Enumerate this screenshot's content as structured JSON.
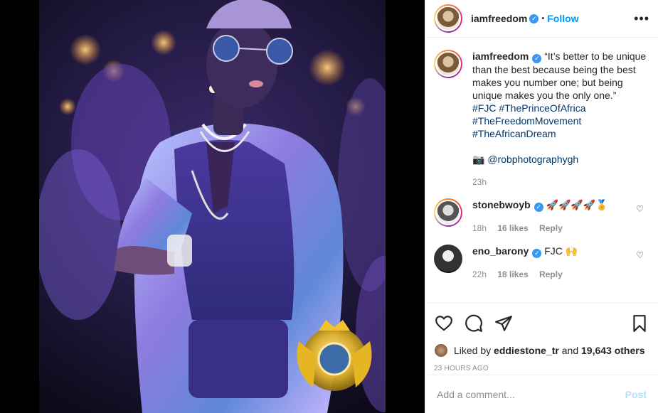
{
  "post": {
    "author": "iamfreedom",
    "follow_label": "Follow",
    "separator": "•",
    "more_label": "•••",
    "verified_mark": "✓",
    "caption": {
      "quote": "“It’s better to be unique than the best because being the best makes you number one; but being unique makes you the only one.”",
      "hashtags": [
        "#FJC #ThePrinceOfAfrica",
        "#TheFreedomMovement",
        "#TheAfricanDream"
      ],
      "camera_emoji": "📷",
      "credit": "@robphotographygh",
      "time": "23h"
    },
    "comments": [
      {
        "user": "stonebwoyb",
        "verified": true,
        "text": "🚀🚀🚀🚀🏅",
        "time": "18h",
        "likes": "16 likes",
        "reply": "Reply"
      },
      {
        "user": "eno_barony",
        "verified": true,
        "text": "FJC 🙌",
        "time": "22h",
        "likes": "18 likes",
        "reply": "Reply"
      }
    ],
    "liked_by_prefix": "Liked by",
    "liked_by_user": "eddiestone_tr",
    "liked_by_and": "and",
    "liked_by_others": "19,643 others",
    "timestamp": "23 HOURS AGO",
    "add_comment_placeholder": "Add a comment...",
    "post_label": "Post"
  },
  "icons": {
    "like": "heart-icon",
    "comment": "comment-icon",
    "share": "paper-plane-icon",
    "save": "bookmark-icon"
  },
  "colors": {
    "accent": "#0095f6",
    "link": "#00376b",
    "muted": "#8e8e8e",
    "verified": "#3897f0",
    "post_disabled": "#b2dffc"
  }
}
